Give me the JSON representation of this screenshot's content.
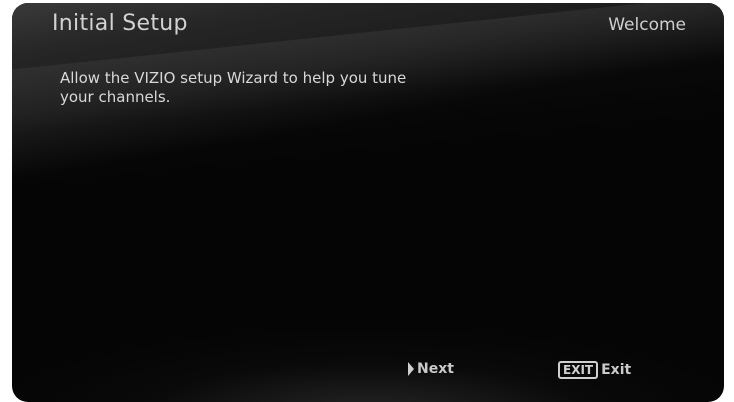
{
  "header": {
    "title": "Initial Setup",
    "breadcrumb": "Welcome"
  },
  "main": {
    "message": "Allow the VIZIO setup Wizard to help you tune your channels."
  },
  "footer": {
    "next_icon": "play-arrow-icon",
    "next_label": "Next",
    "exit_key": "EXIT",
    "exit_label": "Exit"
  },
  "colors": {
    "background": "#050505",
    "text": "#d2d2d2"
  }
}
